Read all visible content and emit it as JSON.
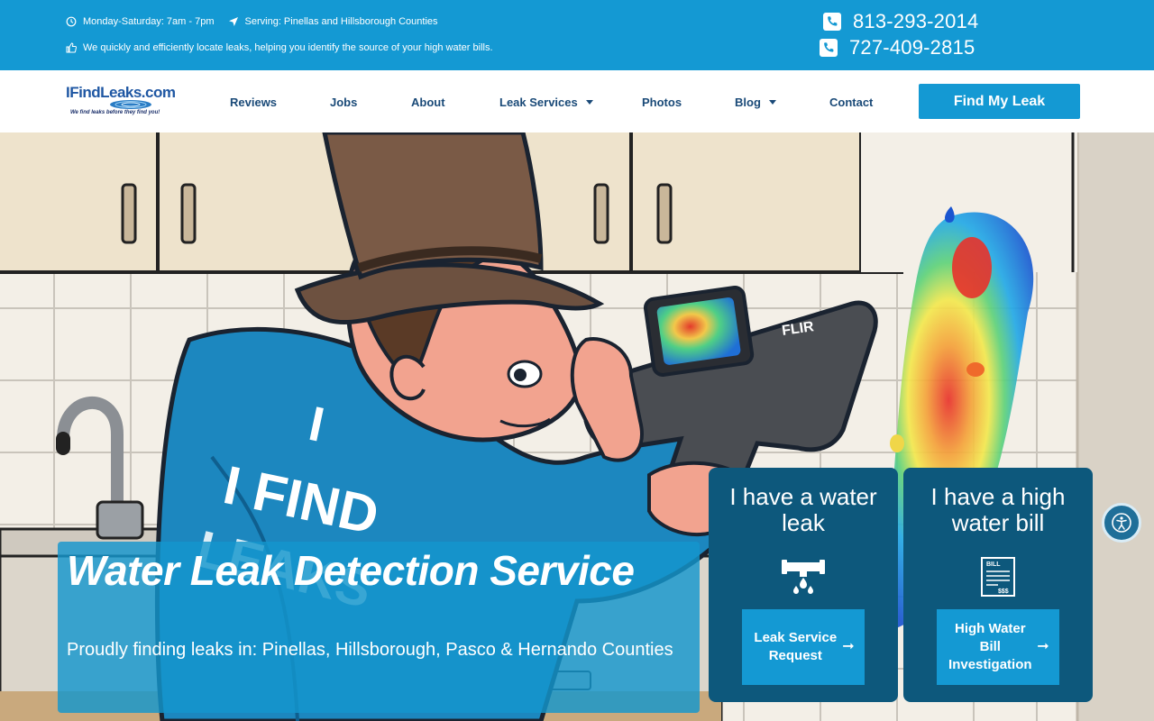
{
  "topbar": {
    "hours": "Monday-Saturday: 7am - 7pm",
    "serving": "Serving: Pinellas and Hillsborough Counties",
    "tagline": "We quickly and efficiently locate leaks, helping you identify the source of your high water bills.",
    "phone_1": "813-293-2014",
    "phone_2": "727-409-2815",
    "icons": [
      "clock-icon",
      "location-arrow-icon",
      "thumbs-up-icon",
      "phone-icon"
    ]
  },
  "nav": {
    "logo_text": "IFindLeaks.com",
    "logo_tagline": "We find leaks before they find you!",
    "items": [
      {
        "label": "Reviews"
      },
      {
        "label": "Jobs"
      },
      {
        "label": "About"
      },
      {
        "label": "Leak Services",
        "has_dropdown": true
      },
      {
        "label": "Photos"
      },
      {
        "label": "Blog",
        "has_dropdown": true
      },
      {
        "label": "Contact"
      }
    ],
    "cta_label": "Find My Leak"
  },
  "hero": {
    "jacket_text_1": "I",
    "jacket_text_2": "I FIND",
    "jacket_text_3": "LEAKS",
    "camera_brand": "FLIR",
    "title": "Water Leak Detection Service",
    "subtitle": "Proudly finding leaks in: Pinellas, Hillsborough, Pasco & Hernando Counties",
    "cards": [
      {
        "title": "I have a water leak",
        "icon": "leaking-pipe-icon",
        "button": "Leak Service Request"
      },
      {
        "title": "I have a high water bill",
        "icon": "water-bill-icon",
        "button": "High Water Bill Investigation"
      }
    ],
    "bill_icon_text": "BILL",
    "bill_icon_amount": "$$$"
  },
  "accessibility": {
    "icon": "accessibility-icon"
  },
  "colors": {
    "brand_blue": "#1499d3",
    "dark_teal": "#0d587c",
    "nav_text": "#1a4a78"
  }
}
